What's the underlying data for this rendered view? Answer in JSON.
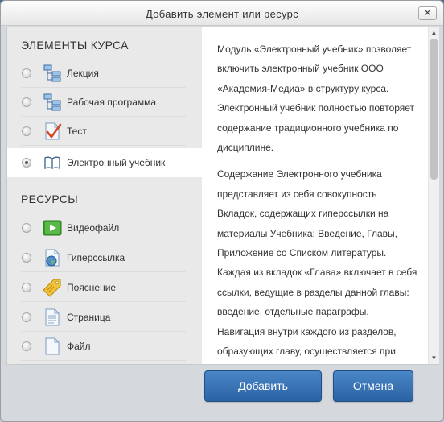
{
  "dialog": {
    "title": "Добавить элемент или ресурс",
    "close_label": "✕"
  },
  "sections": {
    "course_elements": "ЭЛЕМЕНТЫ КУРСА",
    "resources": "РЕСУРСЫ"
  },
  "course_items": [
    {
      "label": "Лекция",
      "icon": "lecture-icon",
      "selected": false
    },
    {
      "label": "Рабочая программа",
      "icon": "work-program-icon",
      "selected": false
    },
    {
      "label": "Тест",
      "icon": "quiz-icon",
      "selected": false
    },
    {
      "label": "Электронный учебник",
      "icon": "book-icon",
      "selected": true
    }
  ],
  "resource_items": [
    {
      "label": "Видеофайл",
      "icon": "video-icon"
    },
    {
      "label": "Гиперссылка",
      "icon": "hyperlink-icon"
    },
    {
      "label": "Пояснение",
      "icon": "label-tag-icon"
    },
    {
      "label": "Страница",
      "icon": "page-icon"
    },
    {
      "label": "Файл",
      "icon": "file-icon"
    }
  ],
  "description": [
    "Модуль «Электронный учебник» позволяет включить электронный учебник ООО «Академия-Медиа» в структуру курса. Электронный учебник полностью повторяет содержание традиционного учебника по дисциплине.",
    "Содержание Электронного учебника представляет из себя совокупность Вкладок, содержащих гиперссылки на материалы Учебника: Введение, Главы, Приложение со Списком литературы. Каждая из вкладок «Глава» включает в себя ссылки, ведущие в разделы данной главы: введение, отдельные параграфы. Навигация внутри каждого из разделов, образующих главу, осуществляется при"
  ],
  "buttons": {
    "add": "Добавить",
    "cancel": "Отмена"
  },
  "colors": {
    "button_blue": "#2f6aaa",
    "quiz_check": "#d9451e",
    "video_green": "#3a9a2a"
  }
}
